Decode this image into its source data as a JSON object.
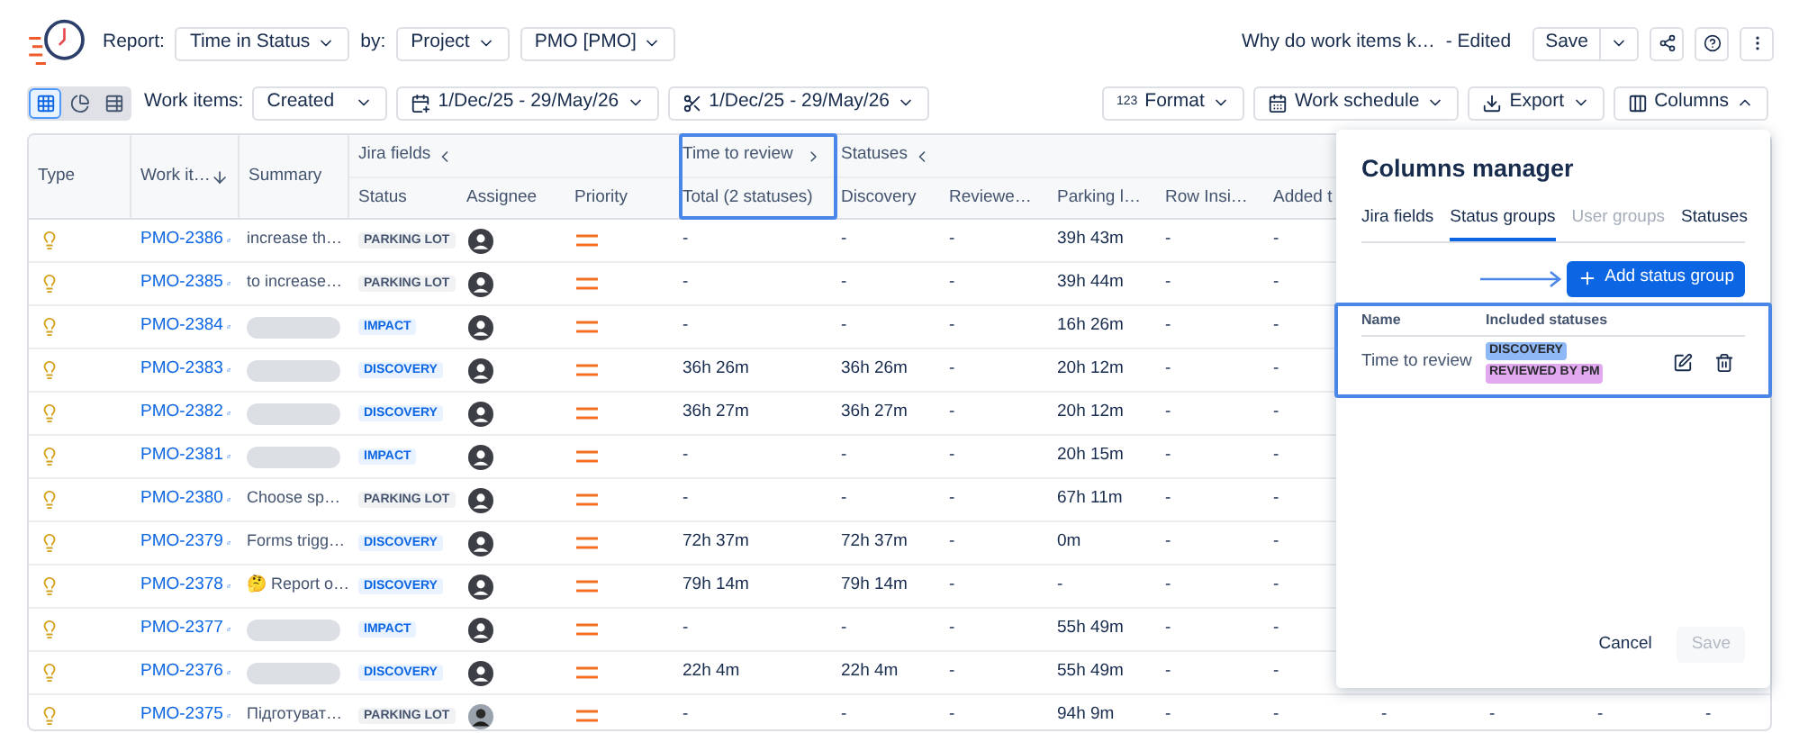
{
  "header": {
    "report_label": "Report:",
    "report": "Time in Status",
    "by_label": "by:",
    "by": "Project",
    "project": "PMO [PMO]",
    "title": "Why do work items k…",
    "edited": "- Edited",
    "save": "Save"
  },
  "toolbar": {
    "views": [
      {
        "kind": "grid",
        "selected": true
      },
      {
        "kind": "chart",
        "selected": false
      },
      {
        "kind": "table",
        "selected": false
      }
    ],
    "items_label": "Work items:",
    "items_value": "Created",
    "created_range": "1/Dec/25 - 29/May/26",
    "resolved_range": "1/Dec/25 - 29/May/26",
    "format_glyph": "123",
    "format": "Format",
    "schedule": "Work schedule",
    "export": "Export",
    "columns": "Columns",
    "columns_expanded": true
  },
  "table": {
    "groups": [
      {
        "label": "Jira fields",
        "expanded": true
      },
      {
        "label": "Time to review",
        "expanded": false
      },
      {
        "label": "Statuses",
        "expanded": true
      }
    ],
    "fixed_columns": [
      "Type",
      "Work it…",
      "Summary"
    ],
    "columns": [
      "Status",
      "Assignee",
      "Priority",
      "Total (2 statuses)",
      "Discovery",
      "Reviewe…",
      "Parking l…",
      "Row Insi…",
      "Added t"
    ],
    "rows": [
      {
        "key": "PMO-2386",
        "summary": "increase th…",
        "status": {
          "label": "PARKING LOT",
          "kind": "neutral"
        },
        "has_photo": false,
        "times": [
          "-",
          "-",
          "-",
          "39h 43m",
          "-",
          "-"
        ]
      },
      {
        "key": "PMO-2385",
        "summary": "to increase…",
        "status": {
          "label": "PARKING LOT",
          "kind": "neutral"
        },
        "has_photo": false,
        "times": [
          "-",
          "-",
          "-",
          "39h 44m",
          "-",
          "-"
        ]
      },
      {
        "key": "PMO-2384",
        "status": {
          "label": "IMPACT",
          "kind": "info"
        },
        "has_photo": false,
        "times": [
          "-",
          "-",
          "-",
          "16h 26m",
          "-",
          "-"
        ]
      },
      {
        "key": "PMO-2383",
        "status": {
          "label": "DISCOVERY",
          "kind": "info"
        },
        "has_photo": false,
        "times": [
          "36h 26m",
          "36h 26m",
          "-",
          "20h 12m",
          "-",
          "-"
        ]
      },
      {
        "key": "PMO-2382",
        "status": {
          "label": "DISCOVERY",
          "kind": "info"
        },
        "has_photo": false,
        "times": [
          "36h 27m",
          "36h 27m",
          "-",
          "20h 12m",
          "-",
          "-"
        ]
      },
      {
        "key": "PMO-2381",
        "status": {
          "label": "IMPACT",
          "kind": "info"
        },
        "has_photo": false,
        "times": [
          "-",
          "-",
          "-",
          "20h 15m",
          "-",
          "-"
        ]
      },
      {
        "key": "PMO-2380",
        "summary": "Choose sp…",
        "status": {
          "label": "PARKING LOT",
          "kind": "neutral"
        },
        "has_photo": false,
        "times": [
          "-",
          "-",
          "-",
          "67h 11m",
          "-",
          "-"
        ]
      },
      {
        "key": "PMO-2379",
        "summary": "Forms trigg…",
        "status": {
          "label": "DISCOVERY",
          "kind": "info"
        },
        "has_photo": false,
        "times": [
          "72h 37m",
          "72h 37m",
          "-",
          "0m",
          "-",
          "-"
        ]
      },
      {
        "key": "PMO-2378",
        "summary": "🤔 Report o…",
        "status": {
          "label": "DISCOVERY",
          "kind": "info"
        },
        "has_photo": false,
        "times": [
          "79h 14m",
          "79h 14m",
          "-",
          "-",
          "-",
          "-"
        ]
      },
      {
        "key": "PMO-2377",
        "status": {
          "label": "IMPACT",
          "kind": "info"
        },
        "has_photo": false,
        "times": [
          "-",
          "-",
          "-",
          "55h 49m",
          "-",
          "-"
        ]
      },
      {
        "key": "PMO-2376",
        "status": {
          "label": "DISCOVERY",
          "kind": "info"
        },
        "has_photo": false,
        "times": [
          "22h 4m",
          "22h 4m",
          "-",
          "55h 49m",
          "-",
          "-"
        ]
      },
      {
        "key": "PMO-2375",
        "summary": "Підготуват…",
        "status": {
          "label": "PARKING LOT",
          "kind": "neutral"
        },
        "has_photo": true,
        "times": [
          "-",
          "-",
          "-",
          "94h 9m",
          "-",
          "-",
          "-",
          "-",
          "-",
          "-"
        ]
      }
    ]
  },
  "columns_manager": {
    "title": "Columns manager",
    "tabs": [
      {
        "label": "Jira fields",
        "selected": false,
        "disabled": false
      },
      {
        "label": "Status groups",
        "selected": true,
        "disabled": false
      },
      {
        "label": "User groups",
        "selected": false,
        "disabled": true
      },
      {
        "label": "Statuses",
        "selected": false,
        "disabled": false
      }
    ],
    "add_button": "Add status group",
    "headers": [
      "Name",
      "Included statuses"
    ],
    "groups": [
      {
        "name": "Time to review",
        "statuses": [
          {
            "label": "DISCOVERY",
            "color": "#8fb8f6"
          },
          {
            "label": "REVIEWED BY PM",
            "color": "#e2a8f0"
          }
        ]
      }
    ],
    "cancel": "Cancel",
    "save": "Save",
    "save_disabled": true
  }
}
